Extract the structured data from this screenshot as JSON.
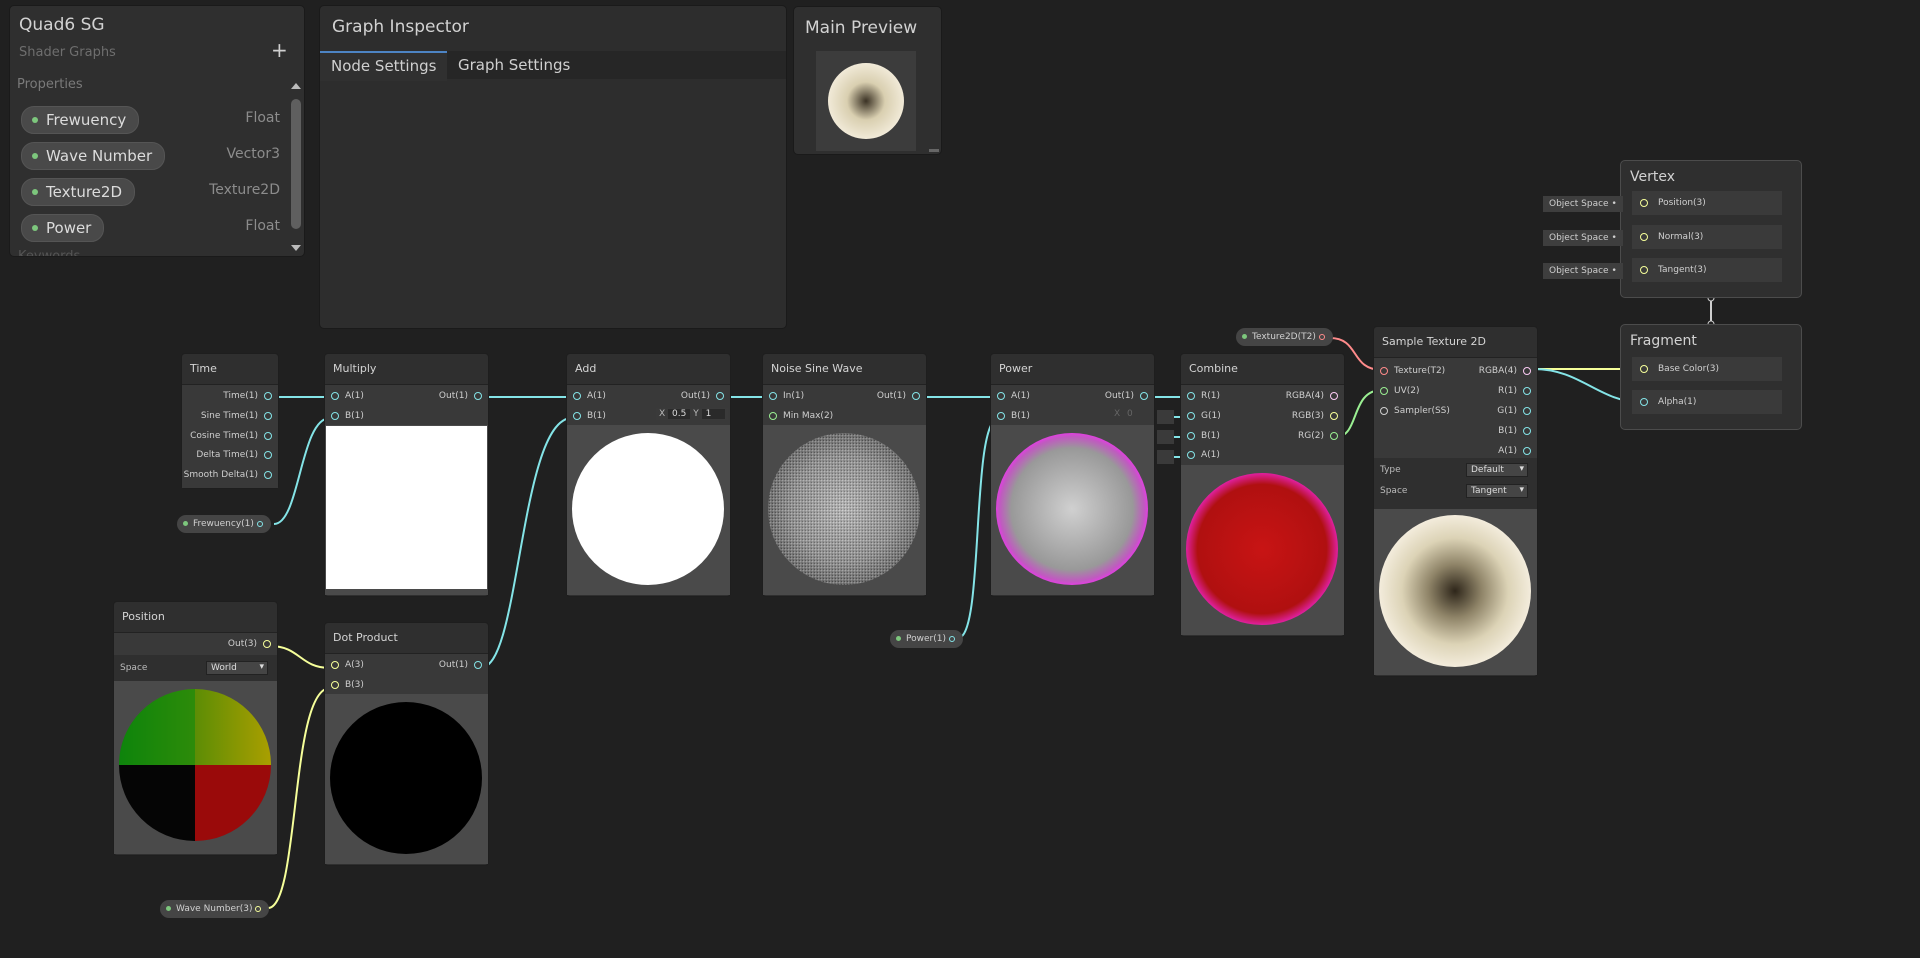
{
  "blackboard": {
    "title": "Quad6 SG",
    "subtitle": "Shader Graphs",
    "add_label": "+",
    "section": "Properties",
    "properties": [
      {
        "name": "Frewuency",
        "type": "Float"
      },
      {
        "name": "Wave Number",
        "type": "Vector3"
      },
      {
        "name": "Texture2D",
        "type": "Texture2D"
      },
      {
        "name": "Power",
        "type": "Float"
      }
    ],
    "keywords_label": "Keywords"
  },
  "inspector": {
    "title": "Graph Inspector",
    "tabs": [
      "Node Settings",
      "Graph Settings"
    ],
    "active_tab": "Node Settings"
  },
  "main_preview": {
    "title": "Main Preview"
  },
  "nodes": {
    "time": {
      "title": "Time",
      "outputs": [
        "Time(1)",
        "Sine Time(1)",
        "Cosine Time(1)",
        "Delta Time(1)",
        "Smooth Delta(1)"
      ]
    },
    "multiply": {
      "title": "Multiply",
      "inputs": [
        "A(1)",
        "B(1)"
      ],
      "outputs": [
        "Out(1)"
      ]
    },
    "add": {
      "title": "Add",
      "inputs": [
        "A(1)",
        "B(1)"
      ],
      "outputs": [
        "Out(1)"
      ]
    },
    "noise": {
      "title": "Noise Sine Wave",
      "inputs": [
        "In(1)",
        "Min Max(2)"
      ],
      "outputs": [
        "Out(1)"
      ],
      "x_label": "X",
      "x_value": "0.5",
      "y_label": "Y",
      "y_value": "1"
    },
    "power": {
      "title": "Power",
      "inputs": [
        "A(1)",
        "B(1)"
      ],
      "outputs": [
        "Out(1)"
      ],
      "x_label": "X",
      "x_value": "0"
    },
    "combine": {
      "title": "Combine",
      "inputs": [
        "R(1)",
        "G(1)",
        "B(1)",
        "A(1)"
      ],
      "outputs": [
        "RGBA(4)",
        "RGB(3)",
        "RG(2)"
      ]
    },
    "sample": {
      "title": "Sample Texture 2D",
      "inputs": [
        "Texture(T2)",
        "UV(2)",
        "Sampler(SS)"
      ],
      "outputs": [
        "RGBA(4)",
        "R(1)",
        "G(1)",
        "B(1)",
        "A(1)"
      ],
      "type_label": "Type",
      "type_value": "Default",
      "space_label": "Space",
      "space_value": "Tangent"
    },
    "position": {
      "title": "Position",
      "outputs": [
        "Out(3)"
      ],
      "space_label": "Space",
      "space_value": "World"
    },
    "dot": {
      "title": "Dot Product",
      "inputs": [
        "A(3)",
        "B(3)"
      ],
      "outputs": [
        "Out(1)"
      ]
    }
  },
  "property_nodes": {
    "frewuency": "Frewuency(1)",
    "wave": "Wave Number(3)",
    "power": "Power(1)",
    "texture": "Texture2D(T2)"
  },
  "master": {
    "vertex_title": "Vertex",
    "vertex_slots": [
      "Position(3)",
      "Normal(3)",
      "Tangent(3)"
    ],
    "object_space": "Object Space",
    "fragment_title": "Fragment",
    "fragment_slots": [
      "Base Color(3)",
      "Alpha(1)"
    ]
  },
  "colors": {
    "float_port": "#84e4e7",
    "vector2_port": "#9aef92",
    "vector3_port": "#f6ff9a",
    "vector4_port": "#fbcbf4",
    "texture_port": "#ff8b8b",
    "panel_bg": "#2f2f2f",
    "canvas_bg": "#202020"
  }
}
